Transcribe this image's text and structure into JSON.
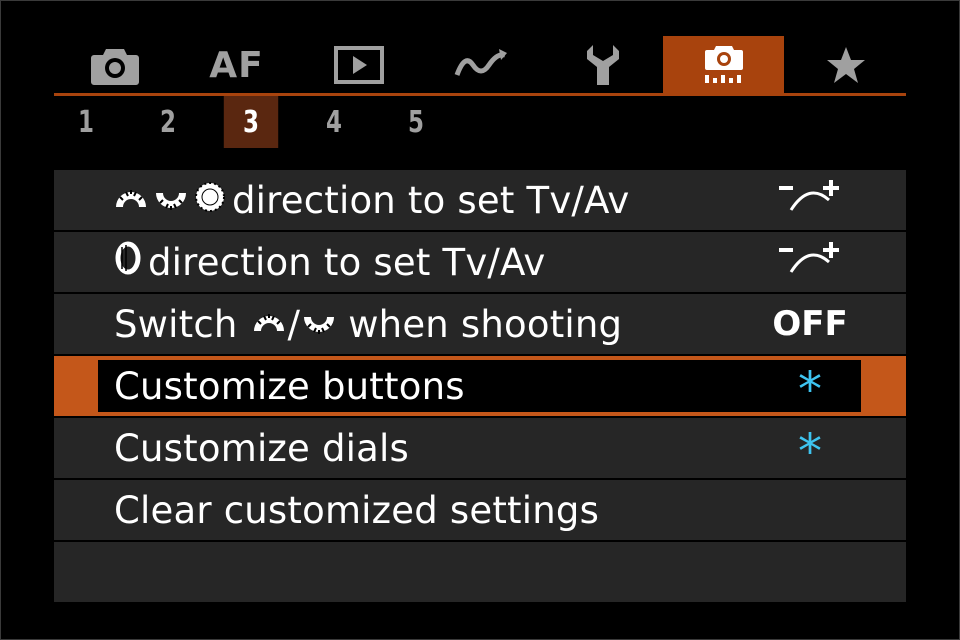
{
  "tabs": {
    "items": [
      {
        "icon": "camera-icon"
      },
      {
        "label": "AF",
        "icon": "af-icon"
      },
      {
        "icon": "playback-icon"
      },
      {
        "icon": "wireless-icon"
      },
      {
        "icon": "wrench-icon"
      },
      {
        "icon": "custom-functions-icon",
        "active": true
      },
      {
        "icon": "star-icon"
      }
    ]
  },
  "pages": {
    "items": [
      "1",
      "2",
      "3",
      "4",
      "5"
    ],
    "active_index": 2
  },
  "menu": {
    "rows": [
      {
        "label": "direction to set Tv/Av",
        "prefix_icons": [
          "main-dial-icon",
          "quick-dial-icon",
          "control-wheel-icon"
        ],
        "value_icon": "dial-direction-icon"
      },
      {
        "label": "direction to set Tv/Av",
        "prefix_icons": [
          "control-ring-icon"
        ],
        "value_icon": "dial-direction-icon"
      },
      {
        "label_parts": [
          "Switch",
          "/",
          "when shooting"
        ],
        "value": "OFF"
      },
      {
        "label": "Customize buttons",
        "value": "*",
        "selected": true
      },
      {
        "label": "Customize dials",
        "value": "*"
      },
      {
        "label": "Clear customized settings"
      }
    ]
  },
  "colors": {
    "accent": "#a8430d",
    "selection": "#c4571a",
    "page_active": "#5a2710",
    "row_bg": "#262626",
    "asterisk": "#3ec4f0",
    "inactive_icon": "#a0a0a0"
  }
}
